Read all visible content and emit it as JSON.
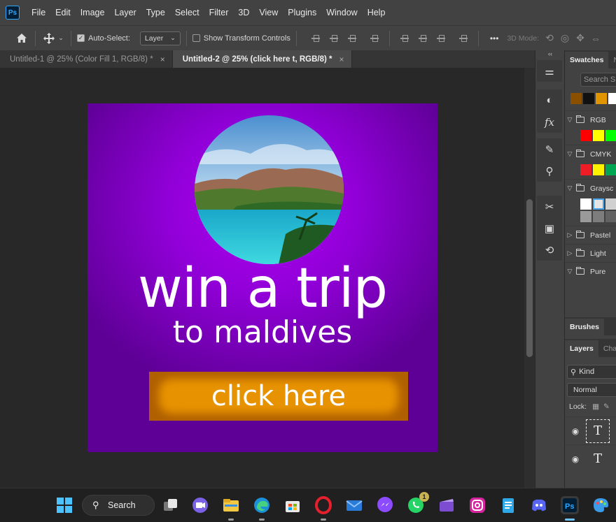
{
  "app": {
    "logo_text": "Ps"
  },
  "menu": [
    "File",
    "Edit",
    "Image",
    "Layer",
    "Type",
    "Select",
    "Filter",
    "3D",
    "View",
    "Plugins",
    "Window",
    "Help"
  ],
  "options_bar": {
    "auto_select_label": "Auto-Select:",
    "auto_select_checked": true,
    "target_select_value": "Layer",
    "show_transform_label": "Show Transform Controls",
    "show_transform_checked": false,
    "more_label": "•••",
    "mode_label": "3D Mode:"
  },
  "tabs": [
    {
      "title": "Untitled-1 @ 25% (Color Fill 1, RGB/8) *",
      "active": false,
      "close": "×"
    },
    {
      "title": "Untitled-2 @ 25% (click here t, RGB/8) *",
      "active": true,
      "close": "×"
    }
  ],
  "canvas": {
    "headline": "win a trip",
    "subline": "to maldives",
    "cta": "click here",
    "colors": {
      "bg_center": "#b000f0",
      "bg_edge": "#5e0096",
      "cta": "#e79200"
    }
  },
  "panels": {
    "collapse_glyph": "‹‹",
    "swatches_tab": "Swatches",
    "next_tab_fragment": "N",
    "search_placeholder": "Search S",
    "recent_swatches": [
      "#8a5000",
      "#111111",
      "#e09400",
      "#ffffff"
    ],
    "swatch_groups": [
      {
        "name": "RGB",
        "open": true,
        "colors": [
          "#ff0000",
          "#ffff00",
          "#00ff00"
        ]
      },
      {
        "name": "CMYK",
        "open": true,
        "colors": [
          "#ee1c24",
          "#fff200",
          "#00a651"
        ]
      },
      {
        "name": "Graysc",
        "open": true,
        "colors": [
          "#ffffff",
          "#e5e5e5",
          "#d0d0d0"
        ]
      },
      {
        "name": "Pastel",
        "open": false
      },
      {
        "name": "Light",
        "open": false
      },
      {
        "name": "Pure",
        "open": true
      }
    ],
    "brushes_tab": "Brushes",
    "layers_tab": "Layers",
    "channels_tab_fragment": "Cha",
    "kind_label": "Kind",
    "blend_mode": "Normal",
    "lock_label": "Lock:",
    "layer_glyph": "T"
  },
  "taskbar": {
    "search_label": "Search",
    "whatsapp_badge": "1"
  }
}
